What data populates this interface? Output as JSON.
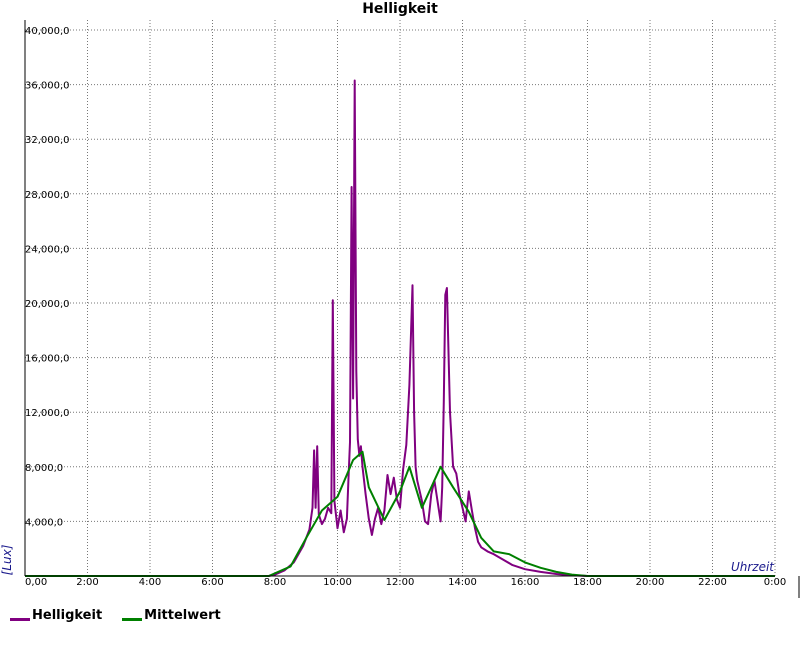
{
  "chart_data": {
    "type": "line",
    "title": "Helligkeit",
    "xlabel": "Uhrzeit",
    "ylabel": "[Lux]",
    "xlim": [
      0,
      24
    ],
    "ylim": [
      0,
      40000
    ],
    "x_ticks": [
      "0,00",
      "2:00",
      "4:00",
      "6:00",
      "8:00",
      "10:00",
      "12:00",
      "14:00",
      "16:00",
      "18:00",
      "20:00",
      "22:00",
      "0:00"
    ],
    "y_ticks": [
      "4,000,0",
      "8,000,0",
      "12,000,0",
      "16,000,0",
      "20,000,0",
      "24,000,0",
      "28,000,0",
      "32,000,0",
      "36,000,0",
      "40,000,0"
    ],
    "grid": true,
    "legend_position": "bottom-left",
    "colors": {
      "Helligkeit": "#800080",
      "Mittelwert": "#008000"
    },
    "series": [
      {
        "name": "Helligkeit",
        "x": [
          0,
          7.8,
          8.0,
          8.3,
          8.6,
          8.9,
          9.1,
          9.2,
          9.25,
          9.3,
          9.35,
          9.4,
          9.5,
          9.6,
          9.7,
          9.8,
          9.85,
          9.9,
          10.0,
          10.1,
          10.2,
          10.3,
          10.35,
          10.4,
          10.45,
          10.5,
          10.55,
          10.6,
          10.65,
          10.7,
          10.75,
          10.8,
          10.9,
          11.0,
          11.1,
          11.2,
          11.3,
          11.4,
          11.5,
          11.6,
          11.7,
          11.8,
          11.9,
          12.0,
          12.1,
          12.2,
          12.3,
          12.4,
          12.45,
          12.5,
          12.55,
          12.6,
          12.7,
          12.8,
          12.9,
          13.0,
          13.1,
          13.2,
          13.3,
          13.35,
          13.4,
          13.45,
          13.5,
          13.6,
          13.7,
          13.8,
          13.9,
          14.0,
          14.1,
          14.2,
          14.3,
          14.4,
          14.5,
          14.6,
          14.8,
          15.0,
          15.3,
          15.6,
          16.0,
          16.5,
          17.0,
          17.5,
          18.0,
          24.0
        ],
        "y": [
          0,
          0,
          100,
          400,
          1000,
          2200,
          3400,
          5000,
          9200,
          5000,
          9500,
          4500,
          3800,
          4200,
          5000,
          4600,
          20200,
          5500,
          3500,
          4800,
          3200,
          4200,
          7000,
          9800,
          28500,
          13000,
          36300,
          15000,
          10000,
          8800,
          9500,
          8000,
          6000,
          4200,
          3000,
          4200,
          5000,
          3800,
          4800,
          7400,
          6000,
          7200,
          5600,
          5000,
          7800,
          9600,
          14000,
          21300,
          12000,
          8000,
          7000,
          6500,
          5500,
          4000,
          3800,
          6000,
          7000,
          5500,
          4000,
          6500,
          12800,
          20600,
          21100,
          12000,
          8000,
          7500,
          6000,
          5000,
          4000,
          6200,
          4800,
          3500,
          2500,
          2100,
          1800,
          1600,
          1200,
          800,
          500,
          300,
          150,
          50,
          0,
          0
        ]
      },
      {
        "name": "Mittelwert",
        "x": [
          0,
          7.8,
          8.5,
          9.0,
          9.5,
          10.0,
          10.5,
          10.8,
          11.0,
          11.5,
          12.0,
          12.3,
          12.7,
          13.3,
          13.7,
          14.2,
          14.6,
          15.0,
          15.5,
          16.0,
          16.5,
          17.0,
          17.5,
          18.0,
          24.0
        ],
        "y": [
          0,
          0,
          700,
          2800,
          4800,
          5800,
          8500,
          9100,
          6500,
          4100,
          6200,
          8000,
          5000,
          8000,
          6500,
          4700,
          2800,
          1800,
          1600,
          1000,
          600,
          300,
          100,
          0,
          0
        ]
      }
    ]
  }
}
